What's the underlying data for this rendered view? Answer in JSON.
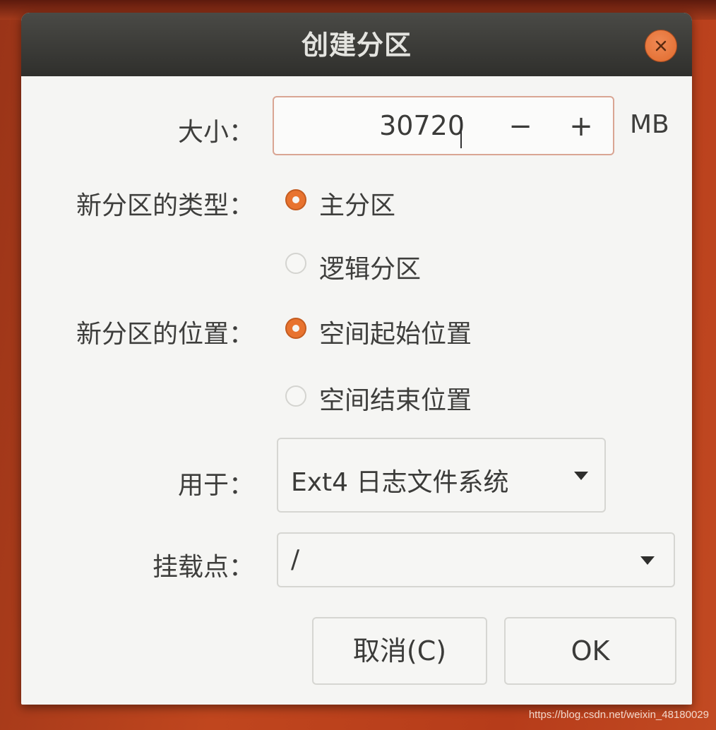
{
  "dialog": {
    "title": "创建分区",
    "close_icon": "close-icon"
  },
  "size": {
    "label": "大小：",
    "value": "30720",
    "decrement_label": "−",
    "increment_label": "+",
    "unit": "MB"
  },
  "partition_type": {
    "label": "新分区的类型：",
    "options": [
      {
        "label": "主分区",
        "selected": true
      },
      {
        "label": "逻辑分区",
        "selected": false
      }
    ]
  },
  "partition_location": {
    "label": "新分区的位置：",
    "options": [
      {
        "label": "空间起始位置",
        "selected": true
      },
      {
        "label": "空间结束位置",
        "selected": false
      }
    ]
  },
  "use_as": {
    "label": "用于：",
    "value": "Ext4 日志文件系统"
  },
  "mount_point": {
    "label": "挂载点：",
    "value": "/"
  },
  "buttons": {
    "cancel": "取消(C)",
    "ok": "OK"
  },
  "watermark": "https://blog.csdn.net/weixin_48180029",
  "colors": {
    "accent": "#e8732f",
    "titlebar": "#3a3a37",
    "dialog_bg": "#f5f5f3"
  }
}
